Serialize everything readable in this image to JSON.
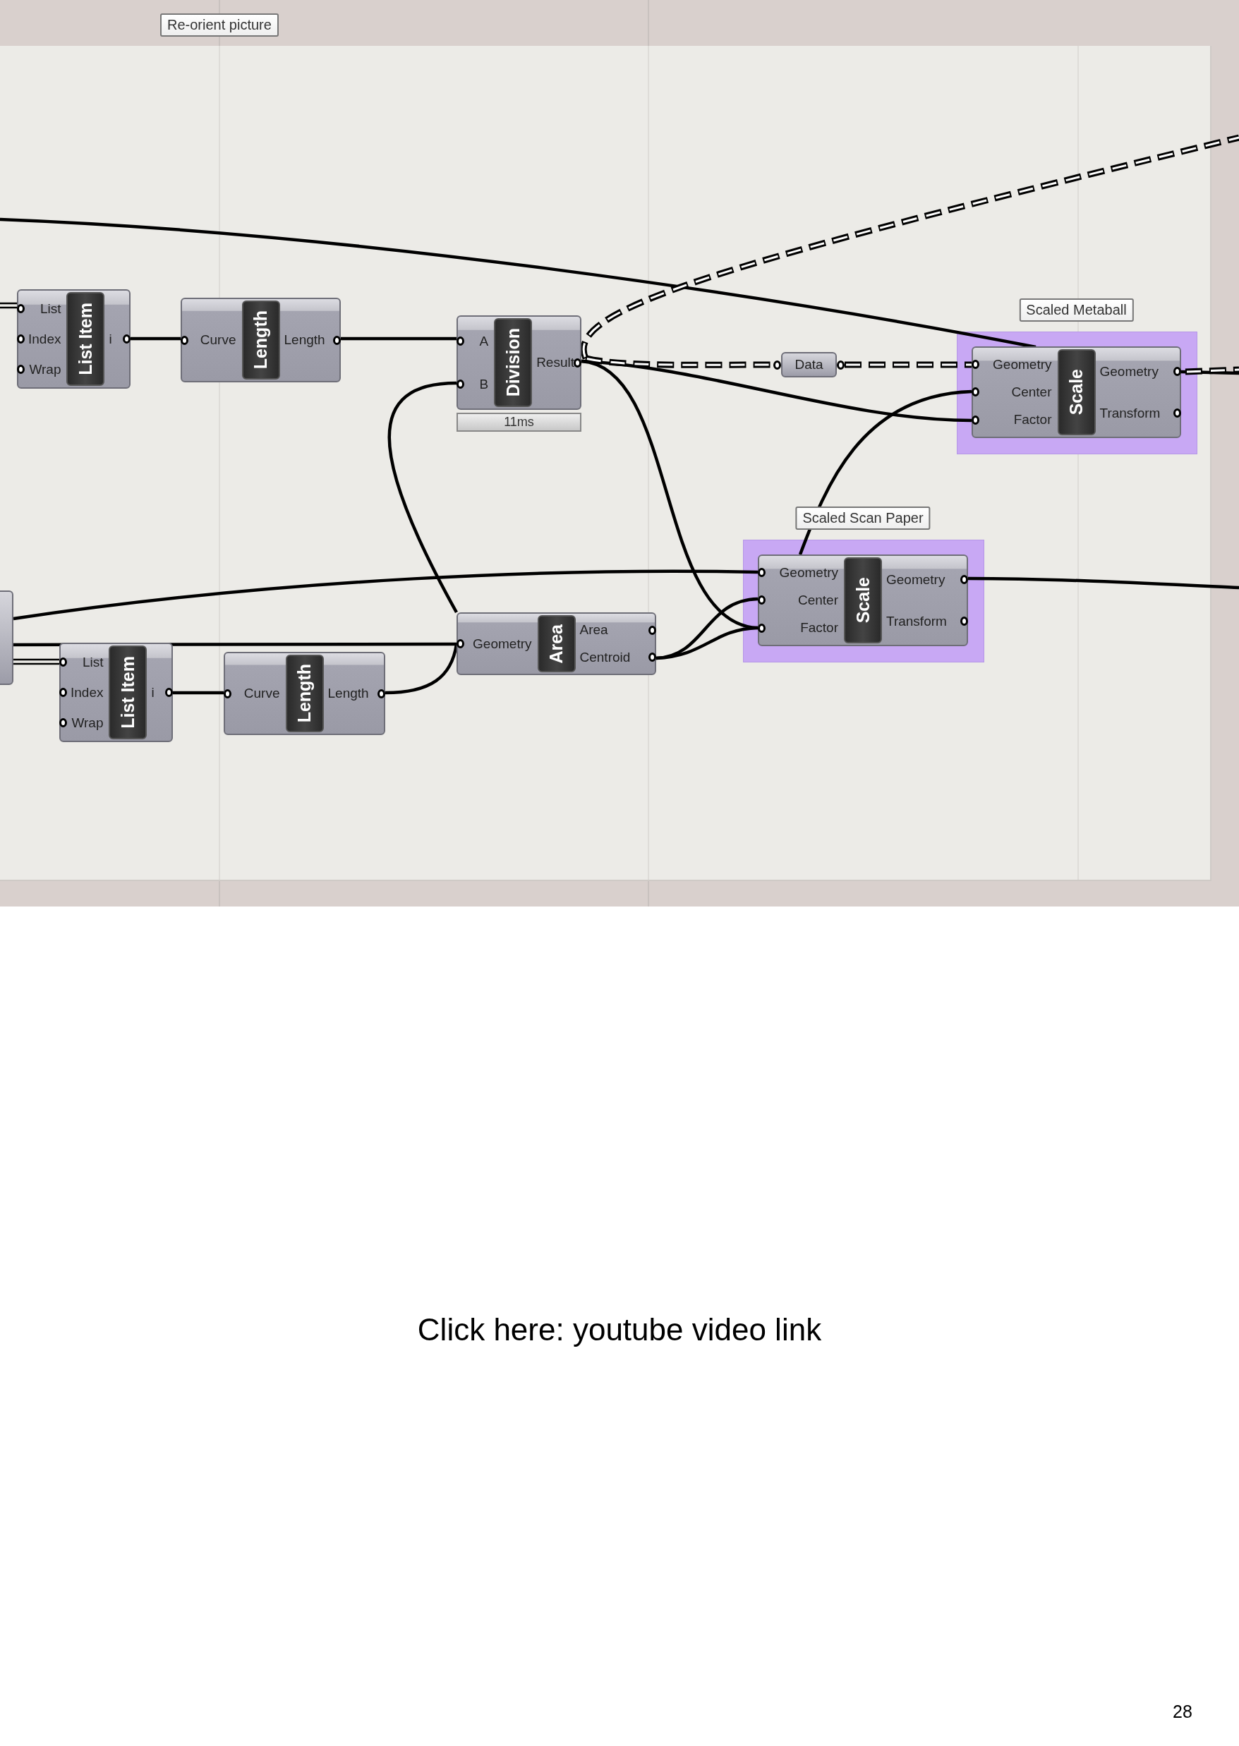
{
  "canvas": {
    "tooltip": "Re-orient picture",
    "nodes": [
      {
        "kind": "component",
        "title": "List Item",
        "inputs": [
          "List",
          "Index",
          "Wrap"
        ],
        "outputs": [
          "i"
        ]
      },
      {
        "kind": "component",
        "title": "Length",
        "inputs": [
          "Curve"
        ],
        "outputs": [
          "Length"
        ]
      },
      {
        "kind": "component",
        "title": "Division",
        "inputs": [
          "A",
          "B"
        ],
        "outputs": [
          "Result"
        ],
        "timer": "11ms"
      },
      {
        "kind": "param",
        "title": "Data"
      },
      {
        "kind": "component",
        "title": "Scale",
        "inputs": [
          "Geometry",
          "Center",
          "Factor"
        ],
        "outputs": [
          "Geometry",
          "Transform"
        ],
        "group": "Scaled Metaball"
      },
      {
        "kind": "component",
        "title": "Area",
        "inputs": [
          "Geometry"
        ],
        "outputs": [
          "Area",
          "Centroid"
        ]
      },
      {
        "kind": "component",
        "title": "Scale",
        "inputs": [
          "Geometry",
          "Center",
          "Factor"
        ],
        "outputs": [
          "Geometry",
          "Transform"
        ],
        "group": "Scaled Scan Paper"
      },
      {
        "kind": "component",
        "title": "List Item",
        "inputs": [
          "List",
          "Index",
          "Wrap"
        ],
        "outputs": [
          "i"
        ]
      },
      {
        "kind": "component",
        "title": "Length",
        "inputs": [
          "Curve"
        ],
        "outputs": [
          "Length"
        ]
      }
    ]
  },
  "link": "Click here: youtube video link",
  "page_number": "28"
}
